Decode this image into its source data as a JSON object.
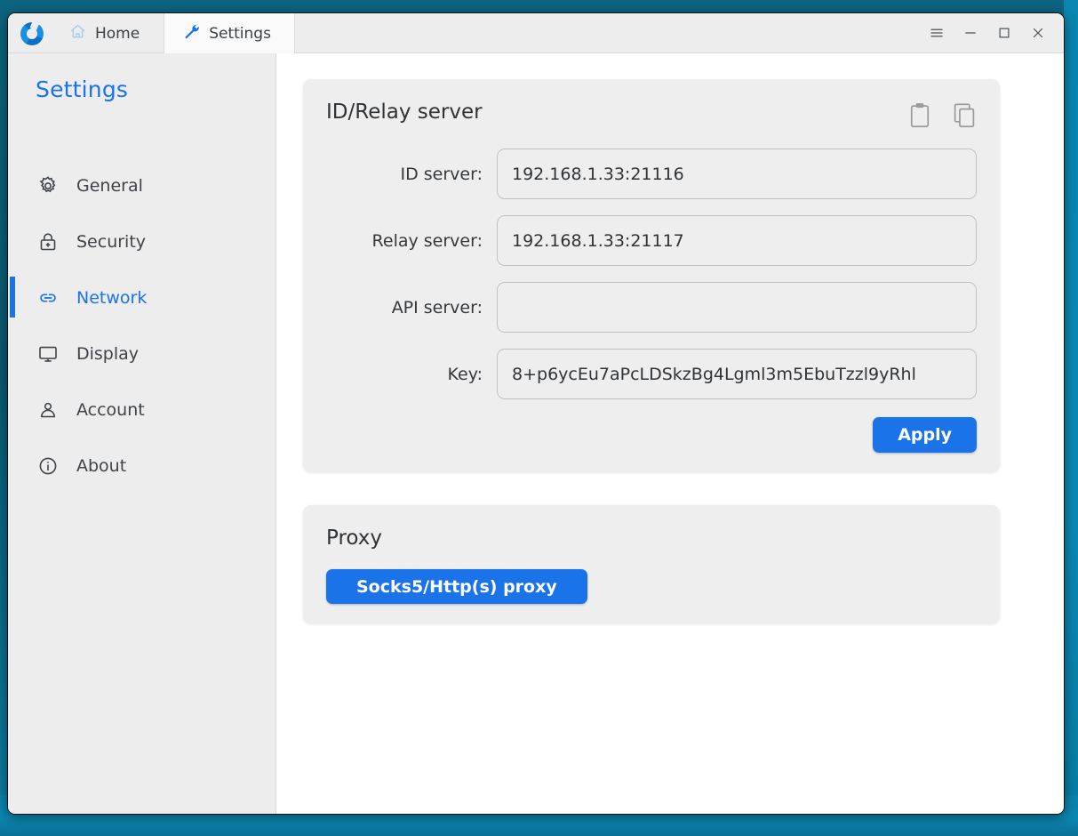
{
  "window": {
    "tabs": [
      {
        "id": "home",
        "label": "Home",
        "icon": "home-icon",
        "active": false
      },
      {
        "id": "settings",
        "label": "Settings",
        "icon": "wrench-icon",
        "active": true
      }
    ],
    "controls": {
      "menu": "≡",
      "minimize": "–",
      "maximize": "□",
      "close": "×"
    }
  },
  "sidebar": {
    "title": "Settings",
    "active_item": "Network",
    "items": [
      {
        "label": "General",
        "icon": "gear-icon"
      },
      {
        "label": "Security",
        "icon": "lock-icon"
      },
      {
        "label": "Network",
        "icon": "link-icon"
      },
      {
        "label": "Display",
        "icon": "monitor-icon"
      },
      {
        "label": "Account",
        "icon": "person-icon"
      },
      {
        "label": "About",
        "icon": "info-icon"
      }
    ]
  },
  "main": {
    "id_relay_card": {
      "title": "ID/Relay server",
      "actions": [
        {
          "name": "paste-icon",
          "title": "paste"
        },
        {
          "name": "copy-icon",
          "title": "copy"
        }
      ],
      "fields": [
        {
          "label": "ID server:",
          "value": "192.168.1.33:21116",
          "placeholder": ""
        },
        {
          "label": "Relay server:",
          "value": "192.168.1.33:21117",
          "placeholder": ""
        },
        {
          "label": "API server:",
          "value": "",
          "placeholder": ""
        },
        {
          "label": "Key:",
          "value": "8+p6ycEu7aPcLDSkzBg4Lgml3m5EbuTzzl9yRhl",
          "placeholder": ""
        }
      ],
      "apply_label": "Apply"
    },
    "proxy_card": {
      "title": "Proxy",
      "button_label": "Socks5/Http(s) proxy"
    }
  },
  "colors": {
    "accent": "#1a73e8",
    "desktop": "#0a6a89",
    "desktop_highlight": "#0b87b2",
    "card_bg": "#eeeeef",
    "sidebar_bg": "#ededee",
    "text": "#35383b"
  }
}
